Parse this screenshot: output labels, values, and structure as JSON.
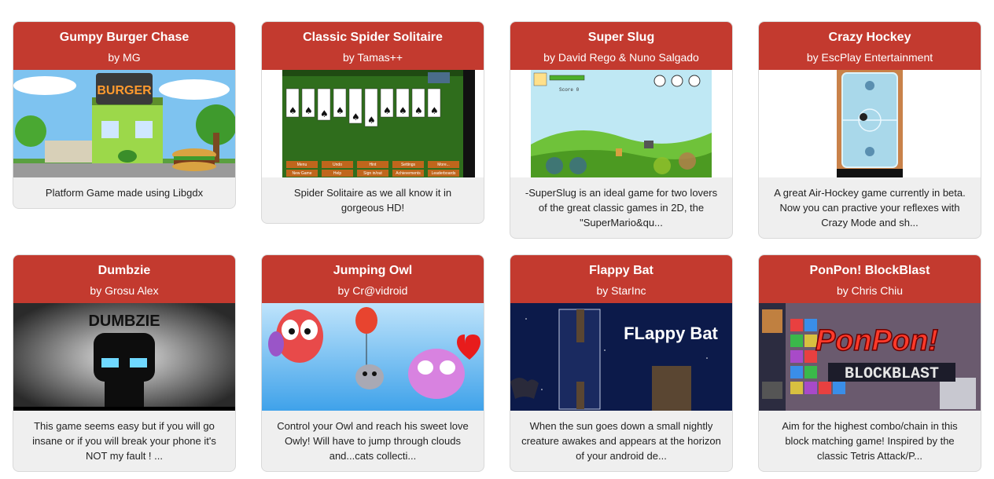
{
  "games": [
    {
      "title": "Gumpy Burger Chase",
      "author": "by MG",
      "description": "Platform Game made using Libgdx",
      "thumb_icon": "burger-shop-thumbnail",
      "thumb_text": "BURGER"
    },
    {
      "title": "Classic Spider Solitaire",
      "author": "by Tamas++",
      "description": "Spider Solitaire as we all know it in gorgeous HD!",
      "thumb_icon": "solitaire-cards-thumbnail",
      "thumb_buttons": [
        "Menu",
        "Undo",
        "Hint",
        "Settings",
        "More...",
        "New Game",
        "Help",
        "Sign in/out",
        "Achievements",
        "Leaderboards"
      ]
    },
    {
      "title": "Super Slug",
      "author": "by David Rego & Nuno Salgado",
      "description": "-SuperSlug is an ideal game for two lovers of the great classic games in 2D, the \"SuperMario&qu...",
      "thumb_icon": "platformer-hills-thumbnail",
      "thumb_text": "Score 0"
    },
    {
      "title": "Crazy Hockey",
      "author": "by EscPlay Entertainment",
      "description": "A great Air-Hockey game currently in beta. Now you can practive your reflexes with Crazy Mode and sh...",
      "thumb_icon": "air-hockey-table-thumbnail"
    },
    {
      "title": "Dumbzie",
      "author": "by Grosu Alex",
      "description": "This game seems easy but if you will go insane or if you will break your phone it's NOT my fault ! ...",
      "thumb_icon": "dark-robot-thumbnail",
      "thumb_text": "DUMBZIE"
    },
    {
      "title": "Jumping Owl",
      "author": "by Cr@vidroid",
      "description": "Control your Owl and reach his sweet love Owly! Will have to jump through clouds and...cats collecti...",
      "thumb_icon": "owls-and-cat-thumbnail"
    },
    {
      "title": "Flappy Bat",
      "author": "by StarInc",
      "description": "When the sun goes down a small nightly creature awakes and appears at the horizon of your android de...",
      "thumb_icon": "night-bat-thumbnail",
      "thumb_text": "FLappy Bat"
    },
    {
      "title": "PonPon! BlockBlast",
      "author": "by Chris Chiu",
      "description": "Aim for the highest combo/chain in this block matching game! Inspired by the classic Tetris Attack/P...",
      "thumb_icon": "block-puzzle-thumbnail",
      "thumb_text": "PonPon!",
      "thumb_subtext": "BLOCKBLAST"
    }
  ],
  "colors": {
    "header": "#c33a2f",
    "card_bg": "#efefef"
  }
}
